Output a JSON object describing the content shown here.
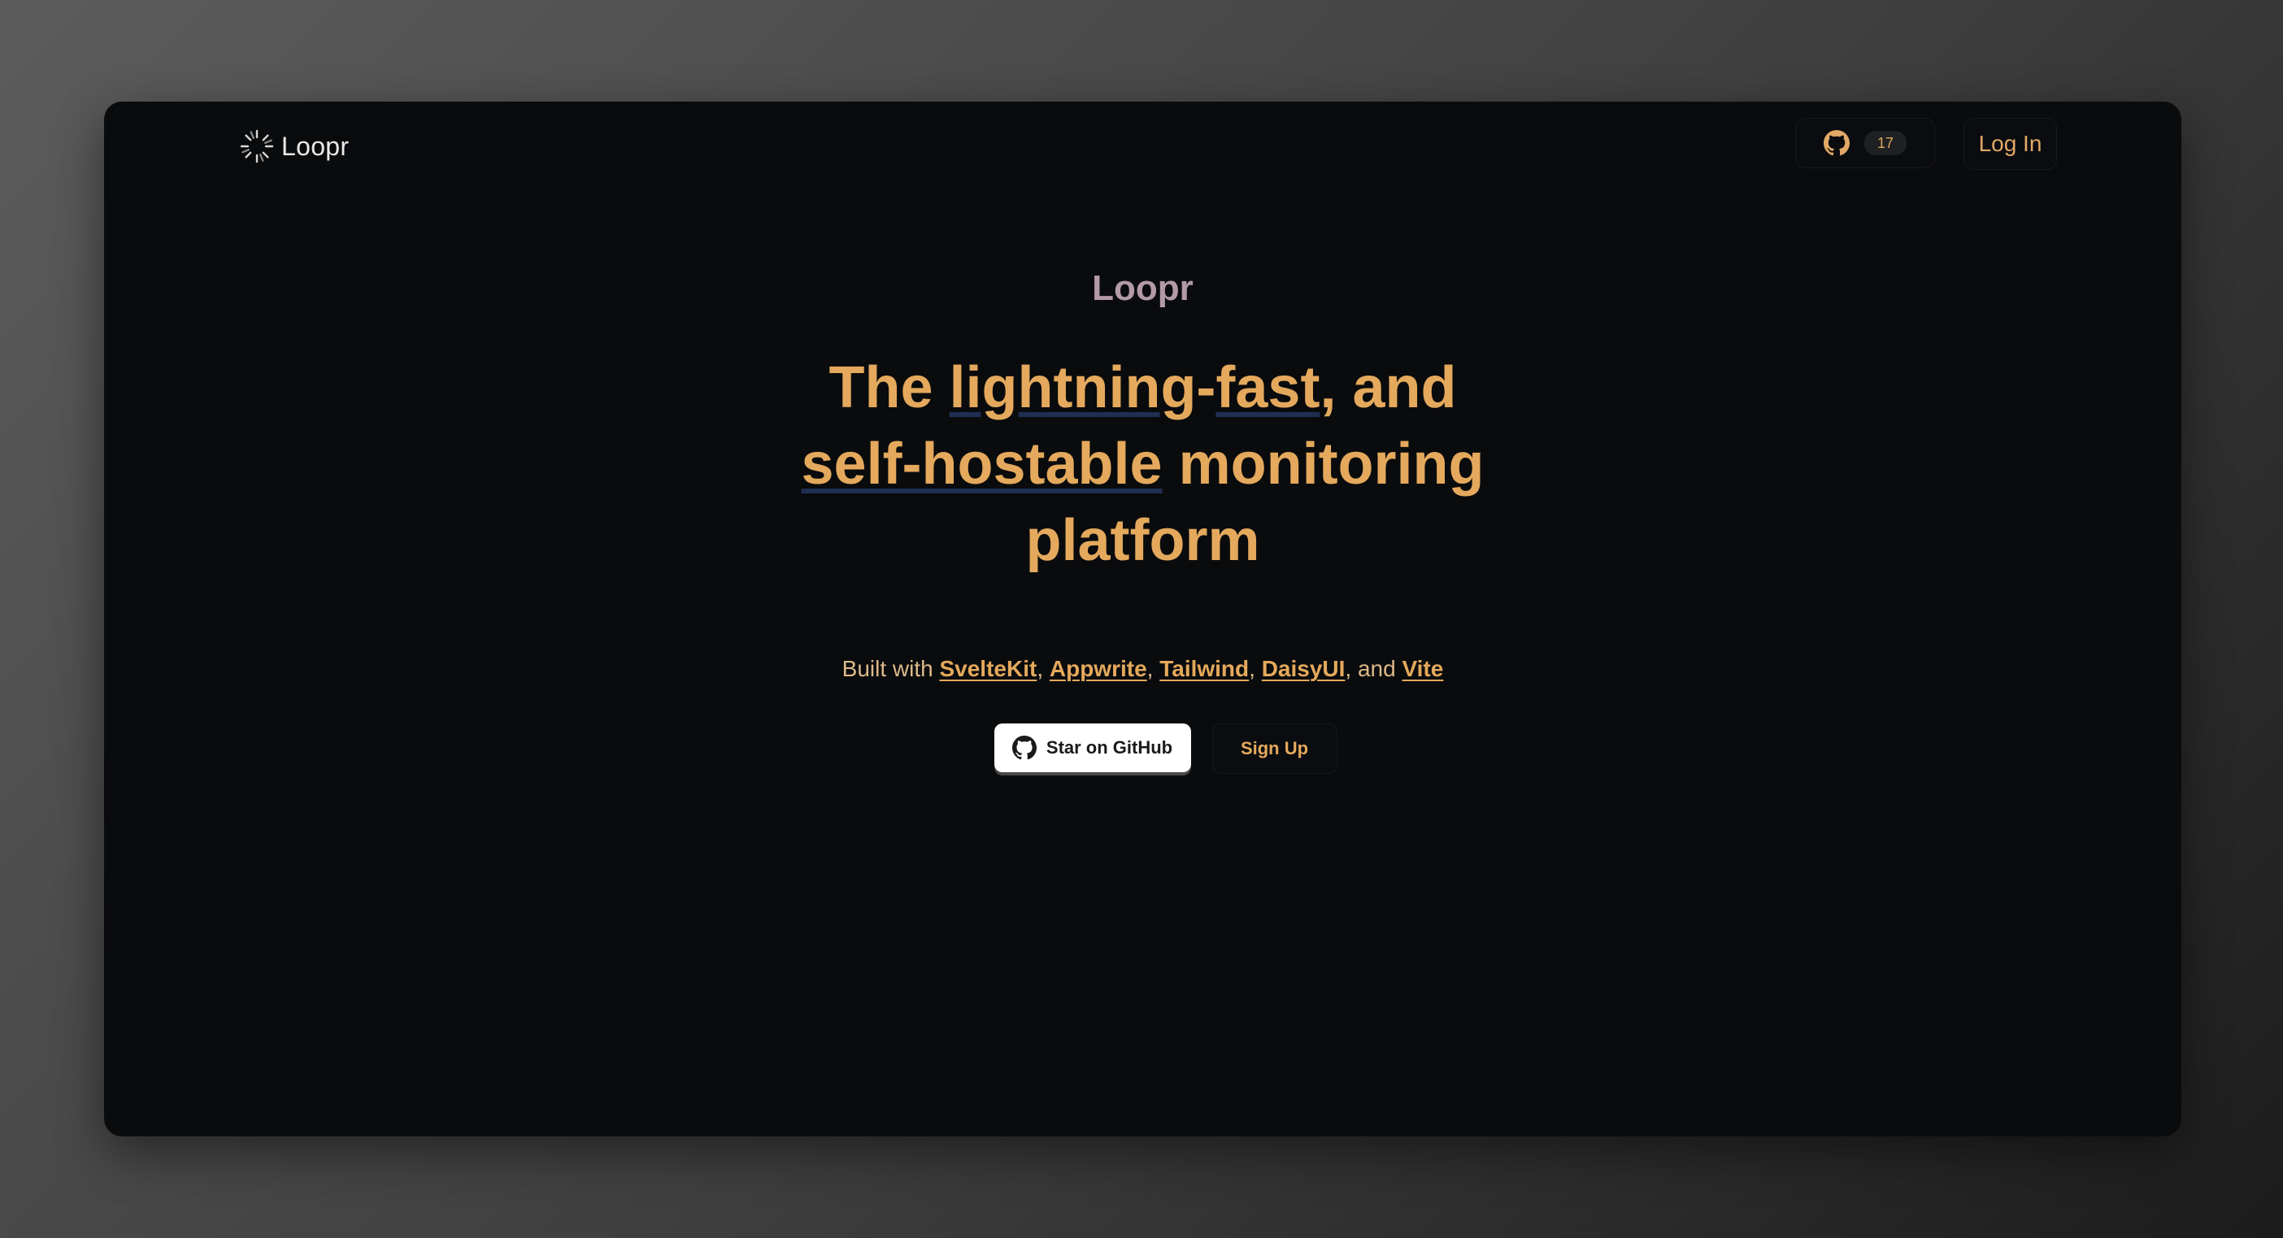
{
  "nav": {
    "brand_name": "Loopr",
    "github_star_count": "17",
    "login_label": "Log In"
  },
  "hero": {
    "kicker": "Loopr",
    "title": {
      "the": "The ",
      "lightning": "lightning",
      "dash": "-",
      "fast": "fast",
      "and": ", and",
      "self_hostable": "self-hostable",
      "monitoring": " monitoring",
      "platform": "platform"
    },
    "built_with": {
      "prefix": "Built with ",
      "sveltekit": "SvelteKit",
      "sep1": ", ",
      "appwrite": "Appwrite",
      "sep2": ", ",
      "tailwind": "Tailwind",
      "sep3": ", ",
      "daisyui": "DaisyUI",
      "sep4": ", and ",
      "vite": "Vite"
    },
    "star_button_label": "Star on GitHub",
    "signup_button_label": "Sign Up"
  },
  "icons": {
    "brand_logo": "loading-spinner-icon",
    "github": "github-icon"
  },
  "colors": {
    "accent": "#e4a95c",
    "background": "#0a0b0d",
    "kicker": "#b39aa8",
    "highlight_underline": "#1e2f52"
  }
}
